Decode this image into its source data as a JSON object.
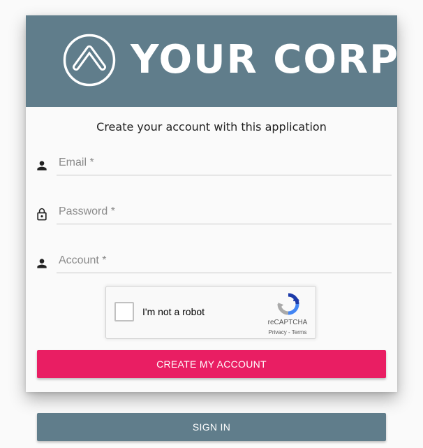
{
  "brand": {
    "name": "YOUR CORP"
  },
  "form": {
    "subtitle": "Create your account with this application",
    "email": {
      "placeholder": "Email *",
      "value": "",
      "icon": "person-icon"
    },
    "password": {
      "placeholder": "Password *",
      "value": "",
      "icon": "lock-icon"
    },
    "account": {
      "placeholder": "Account *",
      "value": "",
      "icon": "person-icon"
    }
  },
  "captcha": {
    "label": "I'm not a robot",
    "brand": "reCAPTCHA",
    "privacy": "Privacy",
    "separator": " - ",
    "terms": "Terms",
    "checked": false
  },
  "actions": {
    "create_label": "CREATE MY ACCOUNT",
    "signin_label": "SIGN IN"
  },
  "colors": {
    "header": "#607d8b",
    "primary": "#e91e63",
    "secondary": "#607d8b"
  }
}
